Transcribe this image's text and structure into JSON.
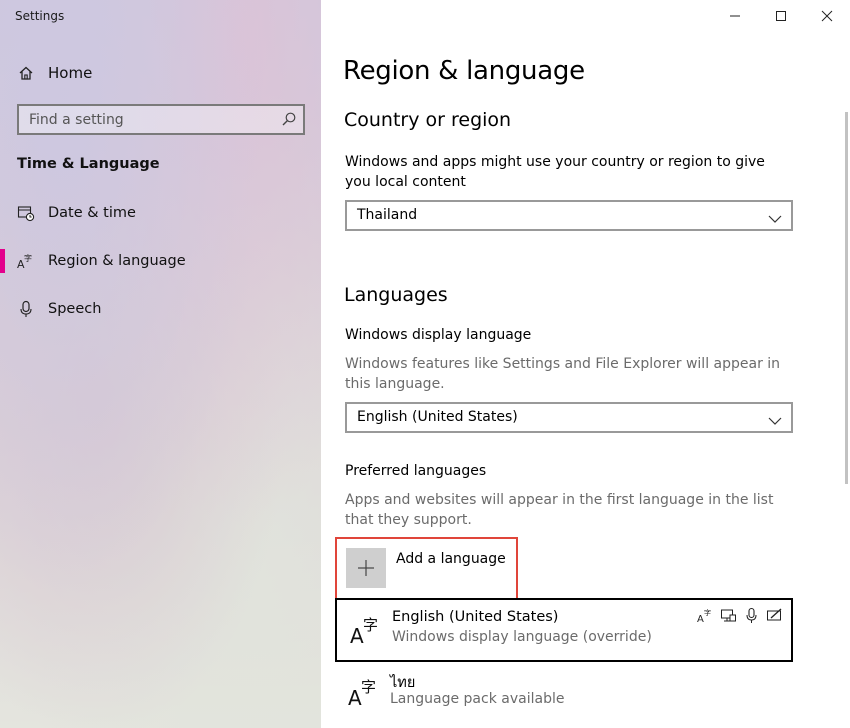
{
  "window": {
    "title": "Settings"
  },
  "sidebar": {
    "home_label": "Home",
    "search_placeholder": "Find a setting",
    "section_title": "Time & Language",
    "items": [
      {
        "label": "Date & time",
        "icon": "calendar-clock-icon"
      },
      {
        "label": "Region & language",
        "icon": "language-icon",
        "active": true
      },
      {
        "label": "Speech",
        "icon": "microphone-icon"
      }
    ],
    "accent_color": "#e3008c"
  },
  "main": {
    "page_title": "Region & language",
    "country": {
      "heading": "Country or region",
      "description": "Windows and apps might use your country or region to give you local content",
      "selected": "Thailand"
    },
    "languages": {
      "heading": "Languages",
      "display_language_label": "Windows display language",
      "display_language_desc": "Windows features like Settings and File Explorer will appear in this language.",
      "display_language_selected": "English (United States)",
      "preferred_label": "Preferred languages",
      "preferred_desc": "Apps and websites will appear in the first language in the list that they support.",
      "add_language_label": "Add a language",
      "list": [
        {
          "name": "English (United States)",
          "status": "Windows display language (override)"
        },
        {
          "name": "ไทย",
          "status": "Language pack available"
        }
      ]
    }
  },
  "highlight_color": "#e0453a"
}
